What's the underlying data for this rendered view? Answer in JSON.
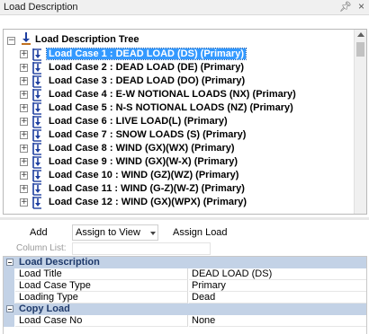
{
  "window": {
    "title": "Load Description",
    "pin_glyph": "∂",
    "close_glyph": "×"
  },
  "tree": {
    "root_label": "Load Description Tree",
    "selected_index": 0,
    "items": [
      {
        "label": "Load Case 1 : DEAD LOAD (DS) (Primary)"
      },
      {
        "label": "Load Case 2 : DEAD LOAD (DE) (Primary)"
      },
      {
        "label": "Load Case 3 : DEAD LOAD (DO) (Primary)"
      },
      {
        "label": "Load Case 4 : E-W NOTIONAL LOADS (NX) (Primary)"
      },
      {
        "label": "Load Case 5 : N-S NOTIONAL LOADS (NZ) (Primary)"
      },
      {
        "label": "Load Case 6 : LIVE LOAD(L) (Primary)"
      },
      {
        "label": "Load Case 7 : SNOW LOADS (S) (Primary)"
      },
      {
        "label": "Load Case 8 : WIND (GX)(WX) (Primary)"
      },
      {
        "label": "Load Case 9 : WIND (GX)(W-X) (Primary)"
      },
      {
        "label": "Load Case 10 : WIND (GZ)(WZ) (Primary)"
      },
      {
        "label": "Load Case 11 : WIND (G-Z)(W-Z) (Primary)"
      },
      {
        "label": "Load Case 12 : WIND (GX)(WPX) (Primary)"
      }
    ],
    "expander_glyph": "+",
    "root_expander_glyph": "−"
  },
  "toolbar": {
    "add_label": "Add",
    "assign_combo_value": "Assign to View",
    "assign_button_label": "Assign Load"
  },
  "column_list": {
    "label": "Column List:",
    "value": ""
  },
  "properties": {
    "sections": [
      {
        "title": "Load Description",
        "rows": [
          {
            "key": "Load Title",
            "value": "DEAD LOAD (DS)"
          },
          {
            "key": "Load Case Type",
            "value": "Primary"
          },
          {
            "key": "Loading Type",
            "value": "Dead"
          }
        ]
      },
      {
        "title": "Copy Load",
        "rows": [
          {
            "key": "Load Case No",
            "value": "None"
          }
        ]
      }
    ]
  },
  "colors": {
    "selection": "#3399ff",
    "section_header": "#c3d2e6",
    "section_text": "#1f3a6b",
    "icon_blue": "#1e3fa0"
  }
}
